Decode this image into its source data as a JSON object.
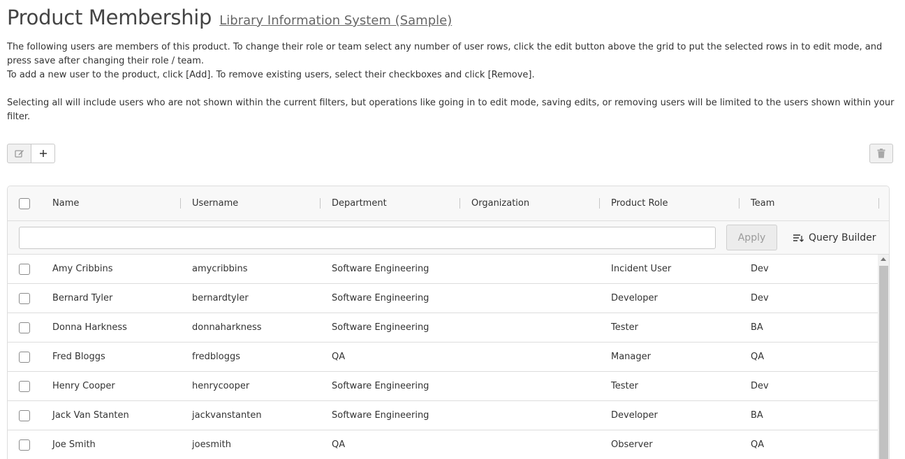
{
  "header": {
    "title": "Product Membership",
    "product_link": "Library Information System (Sample)"
  },
  "description": {
    "line1": "The following users are members of this product. To change their role or team select any number of user rows, click the edit button above the grid to put the selected rows in to edit mode, and press save after changing their role / team.",
    "line2": "To add a new user to the product, click [Add]. To remove existing users, select their checkboxes and click [Remove].",
    "line3": "Selecting all will include users who are not shown within the current filters, but operations like going in to edit mode, saving edits, or removing users will be limited to the users shown within your filter."
  },
  "toolbar": {
    "edit_icon": "edit-icon",
    "add_icon": "plus-icon",
    "remove_icon": "trash-icon"
  },
  "grid": {
    "columns": {
      "name": "Name",
      "username": "Username",
      "department": "Department",
      "organization": "Organization",
      "product_role": "Product Role",
      "team": "Team"
    },
    "filter": {
      "value": "",
      "placeholder": "",
      "apply_label": "Apply",
      "query_builder_label": "Query Builder",
      "query_builder_icon": "query-builder-icon"
    },
    "rows": [
      {
        "name": "Amy Cribbins",
        "username": "amycribbins",
        "department": "Software Engineering",
        "organization": "",
        "product_role": "Incident User",
        "team": "Dev"
      },
      {
        "name": "Bernard Tyler",
        "username": "bernardtyler",
        "department": "Software Engineering",
        "organization": "",
        "product_role": "Developer",
        "team": "Dev"
      },
      {
        "name": "Donna Harkness",
        "username": "donnaharkness",
        "department": "Software Engineering",
        "organization": "",
        "product_role": "Tester",
        "team": "BA"
      },
      {
        "name": "Fred Bloggs",
        "username": "fredbloggs",
        "department": "QA",
        "organization": "",
        "product_role": "Manager",
        "team": "QA"
      },
      {
        "name": "Henry Cooper",
        "username": "henrycooper",
        "department": "Software Engineering",
        "organization": "",
        "product_role": "Tester",
        "team": "Dev"
      },
      {
        "name": "Jack Van Stanten",
        "username": "jackvanstanten",
        "department": "Software Engineering",
        "organization": "",
        "product_role": "Developer",
        "team": "BA"
      },
      {
        "name": "Joe Smith",
        "username": "joesmith",
        "department": "QA",
        "organization": "",
        "product_role": "Observer",
        "team": "QA"
      }
    ]
  }
}
